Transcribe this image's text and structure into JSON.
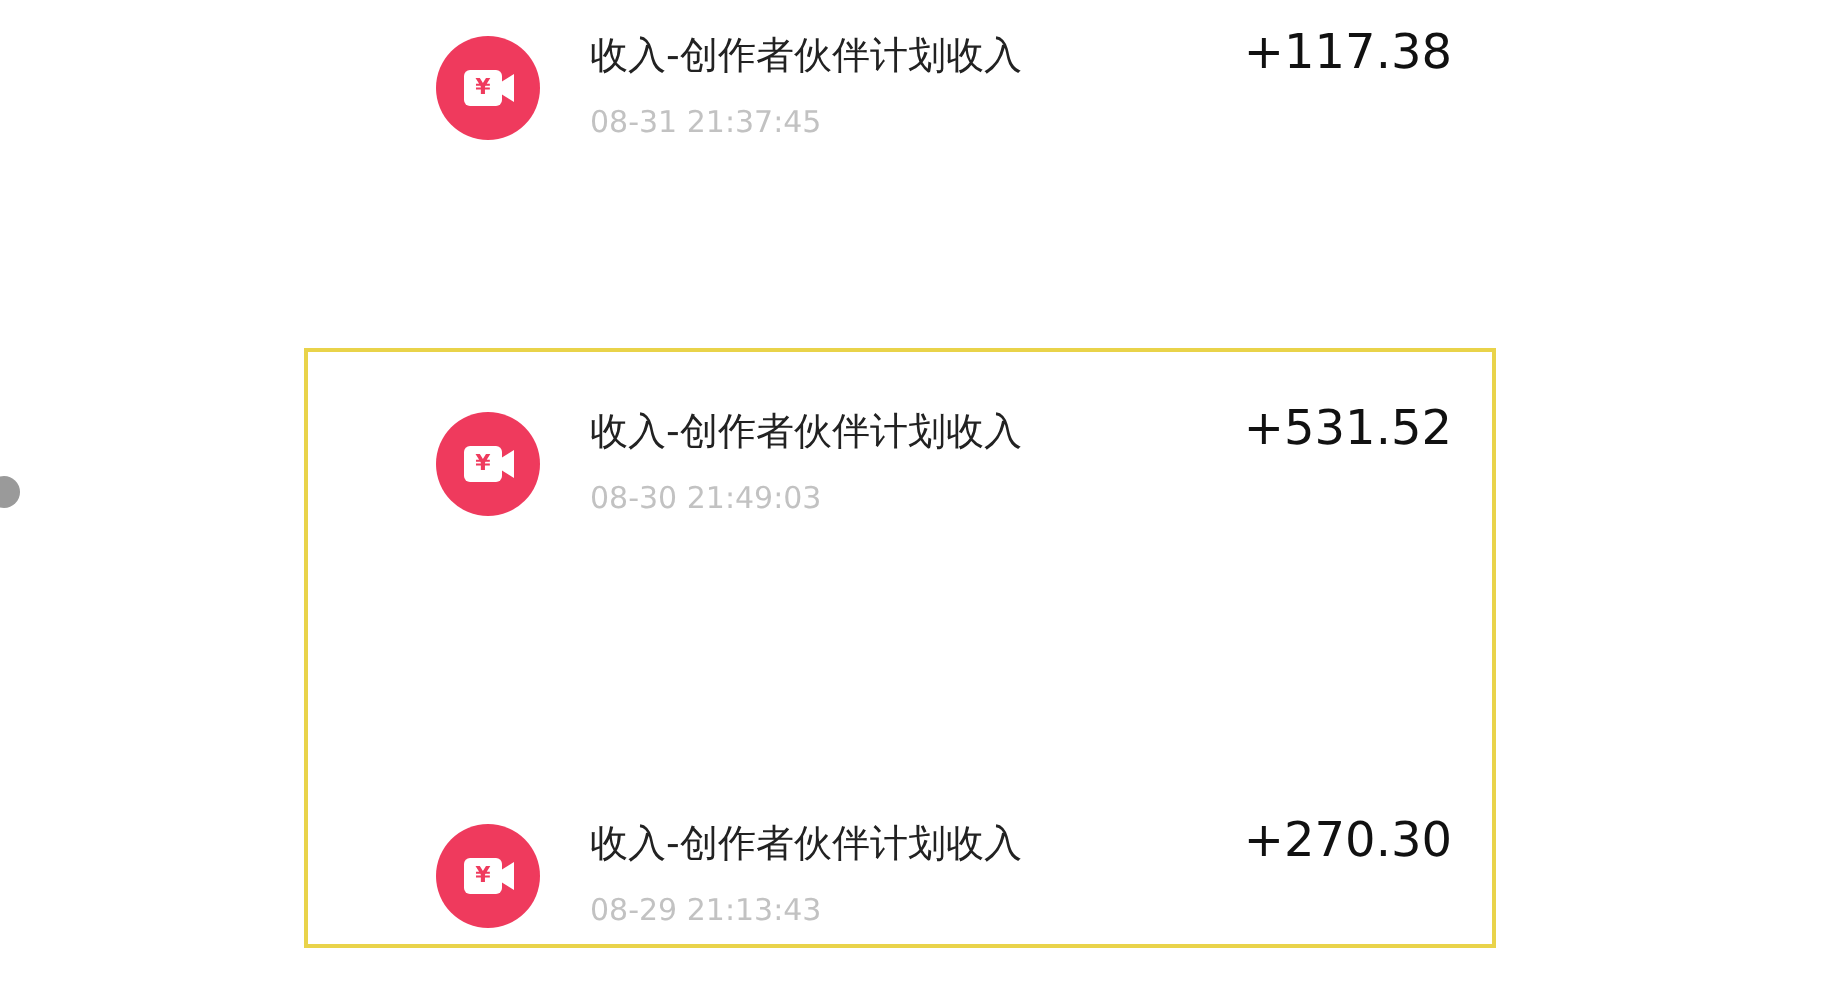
{
  "records": [
    {
      "icon_symbol": "¥",
      "title": "收入-创作者伙伴计划收入",
      "time": "08-31 21:37:45",
      "amount": "+117.38"
    }
  ],
  "highlight_box": {
    "records": [
      {
        "icon_symbol": "¥",
        "title": "收入-创作者伙伴计划收入",
        "time": "08-30 21:49:03",
        "amount": "+531.52"
      },
      {
        "icon_symbol": "¥",
        "title": "收入-创作者伙伴计划收入",
        "time": "08-29 21:13:43",
        "amount": "+270.30"
      }
    ]
  }
}
